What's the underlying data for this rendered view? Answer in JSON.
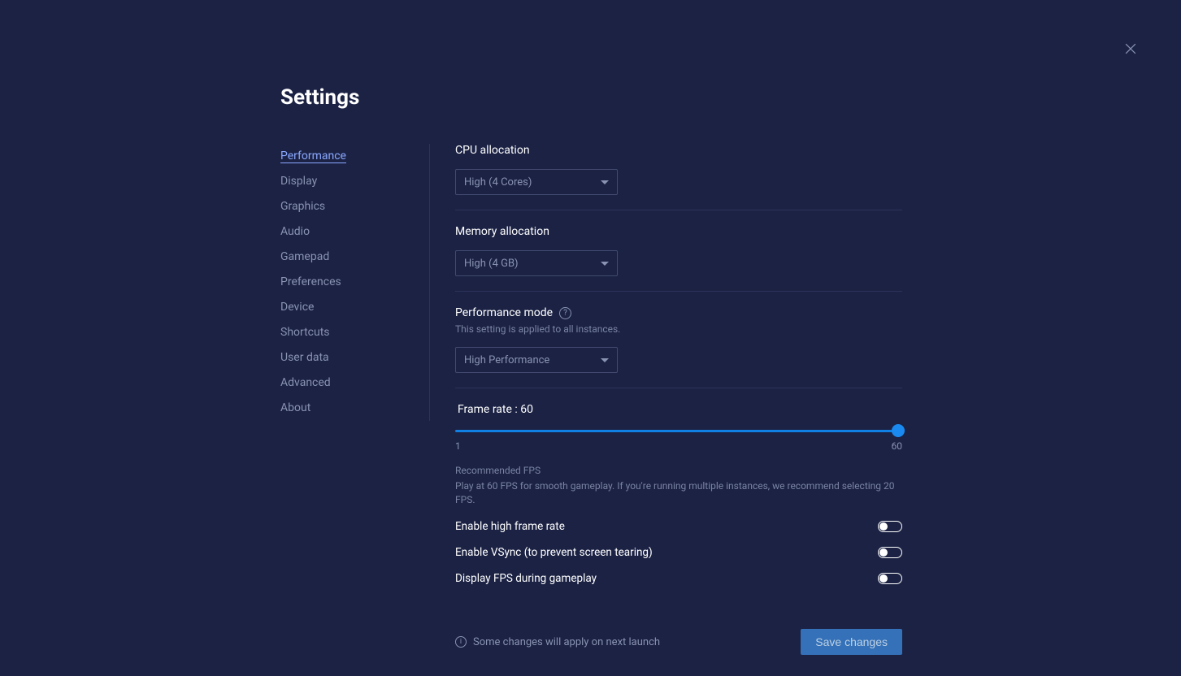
{
  "page_title": "Settings",
  "sidebar": {
    "items": [
      {
        "label": "Performance",
        "active": true
      },
      {
        "label": "Display",
        "active": false
      },
      {
        "label": "Graphics",
        "active": false
      },
      {
        "label": "Audio",
        "active": false
      },
      {
        "label": "Gamepad",
        "active": false
      },
      {
        "label": "Preferences",
        "active": false
      },
      {
        "label": "Device",
        "active": false
      },
      {
        "label": "Shortcuts",
        "active": false
      },
      {
        "label": "User data",
        "active": false
      },
      {
        "label": "Advanced",
        "active": false
      },
      {
        "label": "About",
        "active": false
      }
    ]
  },
  "sections": {
    "cpu": {
      "label": "CPU allocation",
      "value": "High (4 Cores)"
    },
    "memory": {
      "label": "Memory allocation",
      "value": "High (4 GB)"
    },
    "perf_mode": {
      "label": "Performance mode",
      "subtext": "This setting is applied to all instances.",
      "value": "High Performance"
    },
    "frame_rate": {
      "title": "Frame rate : 60",
      "min_label": "1",
      "max_label": "60",
      "value": 60,
      "recommended_title": "Recommended FPS",
      "recommended_text": "Play at 60 FPS for smooth gameplay. If you're running multiple instances, we recommend selecting 20 FPS."
    },
    "toggles": {
      "high_fps": {
        "label": "Enable high frame rate",
        "on": false
      },
      "vsync": {
        "label": "Enable VSync (to prevent screen tearing)",
        "on": false
      },
      "display_fps": {
        "label": "Display FPS during gameplay",
        "on": false
      }
    }
  },
  "footer": {
    "note": "Some changes will apply on next launch",
    "save_label": "Save changes"
  }
}
